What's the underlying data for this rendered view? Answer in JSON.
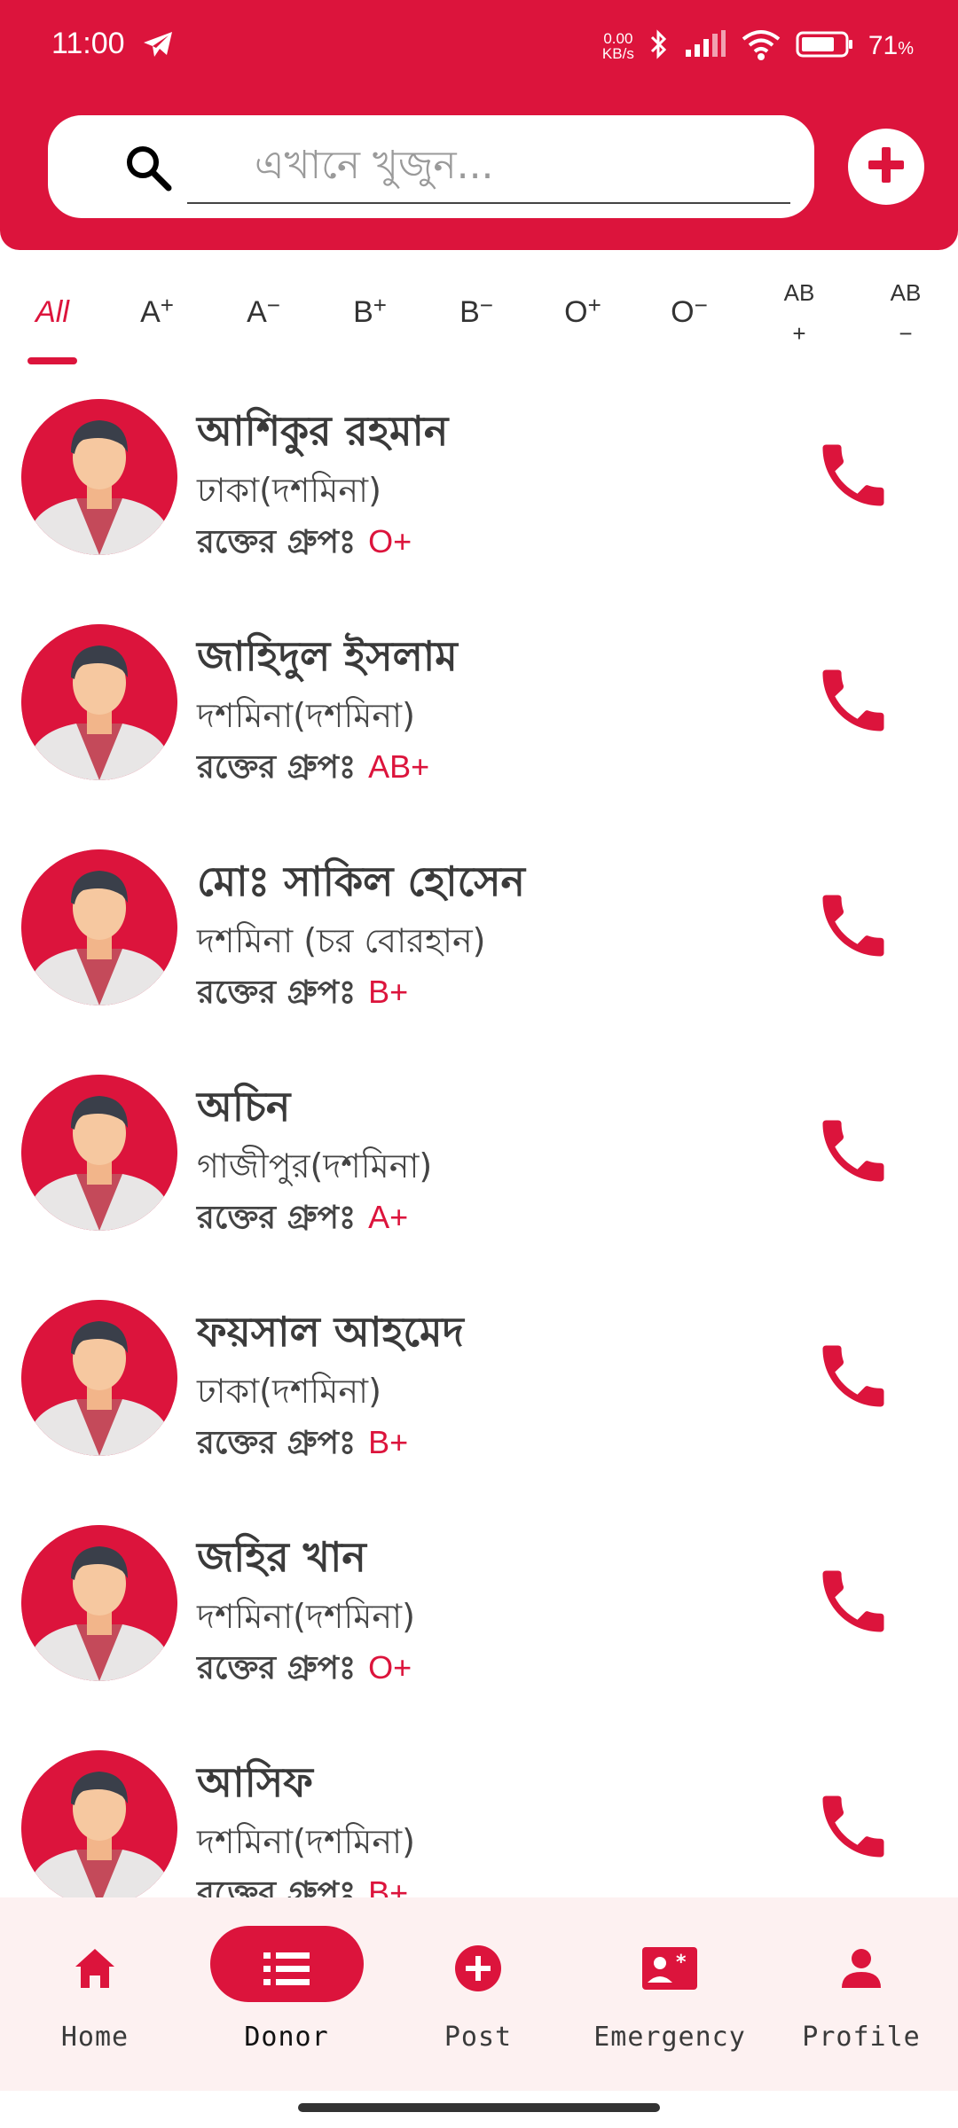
{
  "status_bar": {
    "time": "11:00",
    "net_speed_value": "0.00",
    "net_speed_unit": "KB/s",
    "battery_percent": "71",
    "battery_unit": "%"
  },
  "search": {
    "placeholder": "এখানে খুজুন..."
  },
  "filters": {
    "all": "All",
    "a": "A",
    "a_pos": "+",
    "a_neg": "−",
    "b": "B",
    "b_pos": "+",
    "b_neg": "−",
    "o": "O",
    "o_pos": "+",
    "o_neg": "−",
    "ab": "AB",
    "ab_pos": "+",
    "ab_neg": "−"
  },
  "blood_label": "রক্তের গ্রুপঃ",
  "donors": [
    {
      "name": "আশিকুর রহমান",
      "location": "ঢাকা(দশমিনা)",
      "blood": "O+"
    },
    {
      "name": "জাহিদুল ইসলাম",
      "location": "দশমিনা(দশমিনা)",
      "blood": "AB+"
    },
    {
      "name": "মোঃ সাকিল হোসেন",
      "location": "দশমিনা (চর বোরহান)",
      "blood": "B+"
    },
    {
      "name": "অচিন",
      "location": "গাজীপুর(দশমিনা)",
      "blood": "A+"
    },
    {
      "name": "ফয়সাল আহমেদ",
      "location": "ঢাকা(দশমিনা)",
      "blood": "B+"
    },
    {
      "name": "জহির খান",
      "location": "দশমিনা(দশমিনা)",
      "blood": "O+"
    },
    {
      "name": "আসিফ",
      "location": "দশমিনা(দশমিনা)",
      "blood": "B+"
    }
  ],
  "nav": {
    "home": "Home",
    "donor": "Donor",
    "post": "Post",
    "emergency": "Emergency",
    "profile": "Profile",
    "active": "donor"
  },
  "colors": {
    "accent": "#dc143c",
    "nav_background": "#fdf1f1"
  }
}
